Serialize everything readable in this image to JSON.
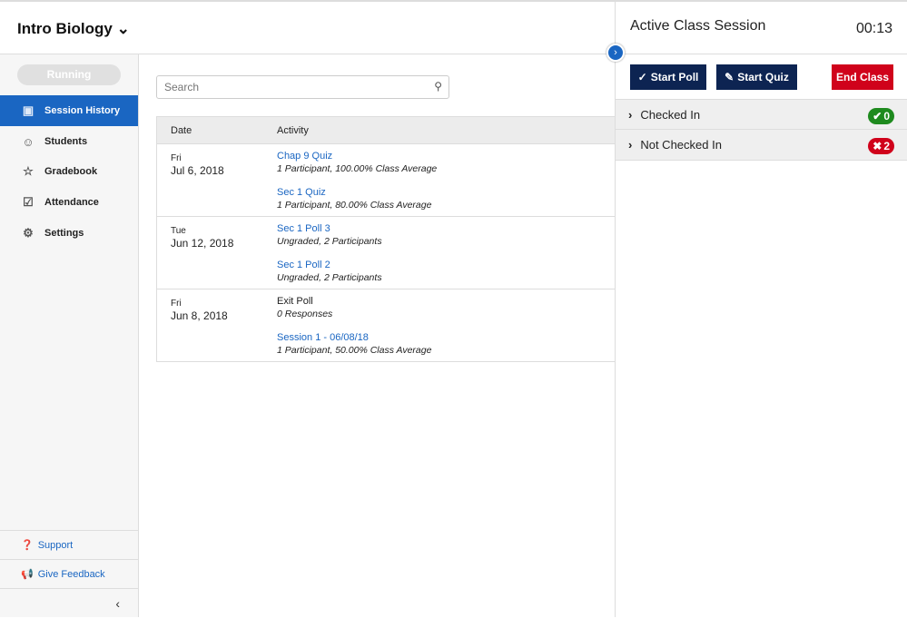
{
  "header": {
    "course_title": "Intro Biology"
  },
  "sidebar": {
    "status": "Running",
    "items": [
      {
        "label": "Session History",
        "icon": "presentation-icon",
        "active": true
      },
      {
        "label": "Students",
        "icon": "people-icon"
      },
      {
        "label": "Gradebook",
        "icon": "gradebook-icon"
      },
      {
        "label": "Attendance",
        "icon": "calendar-check-icon"
      },
      {
        "label": "Settings",
        "icon": "gear-icon"
      }
    ],
    "support": "Support",
    "feedback": "Give Feedback"
  },
  "search": {
    "placeholder": "Search"
  },
  "table": {
    "headers": [
      "Date",
      "Activity"
    ],
    "rows": [
      {
        "day": "Fri",
        "date": "Jul 6, 2018",
        "activities": [
          {
            "title": "Chap 9 Quiz",
            "detail": "1 Participant, 100.00% Class Average"
          },
          {
            "title": "Sec 1 Quiz",
            "detail": "1 Participant, 80.00% Class Average"
          }
        ]
      },
      {
        "day": "Tue",
        "date": "Jun 12, 2018",
        "activities": [
          {
            "title": "Sec 1 Poll 3",
            "detail": "Ungraded, 2 Participants"
          },
          {
            "title": "Sec 1 Poll 2",
            "detail": "Ungraded, 2 Participants"
          }
        ]
      },
      {
        "day": "Fri",
        "date": "Jun 8, 2018",
        "activities": [
          {
            "title": "Exit Poll",
            "detail": "0 Responses"
          },
          {
            "title": "Session 1 - 06/08/18",
            "detail": "1 Participant, 50.00% Class Average"
          }
        ]
      }
    ]
  },
  "panel": {
    "title": "Active Class Session",
    "timer": "00:13",
    "start_poll": "Start Poll",
    "start_quiz": "Start Quiz",
    "end_class": "End Class",
    "groups": [
      {
        "label": "Checked In",
        "count": "0",
        "color": "#1e8a1e"
      },
      {
        "label": "Not Checked In",
        "count": "2",
        "color": "#d0021b"
      }
    ]
  }
}
